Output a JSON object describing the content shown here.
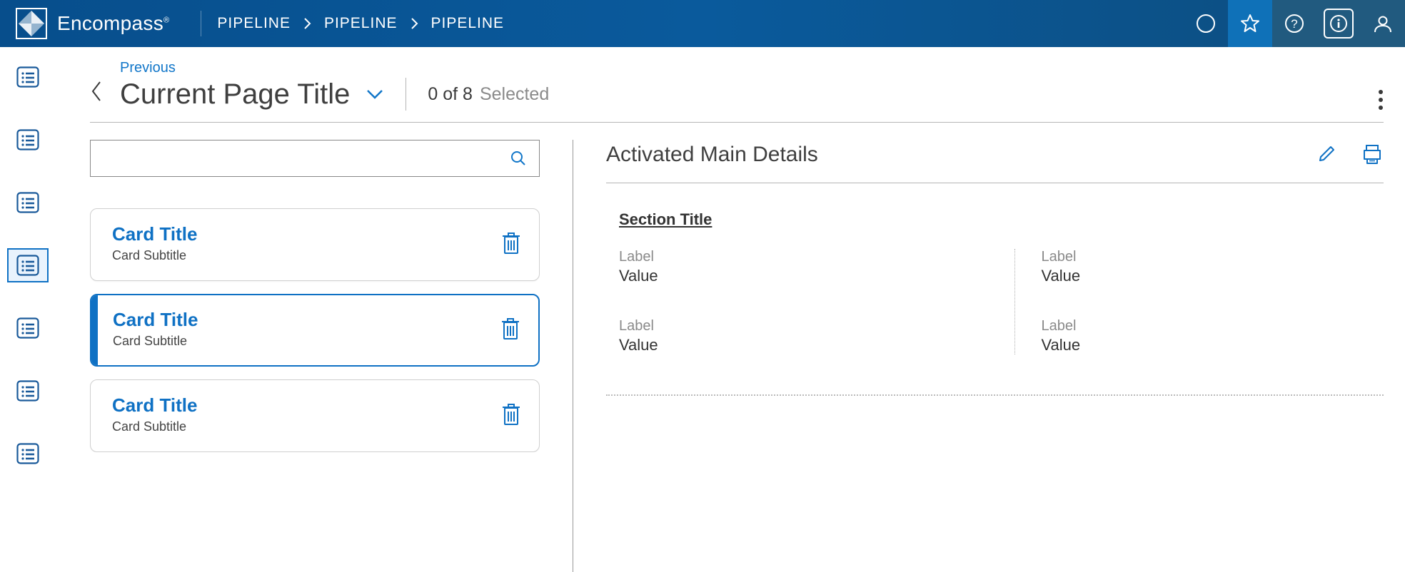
{
  "brand": {
    "name": "Encompass"
  },
  "breadcrumb": [
    "PIPELINE",
    "PIPELINE",
    "PIPELINE"
  ],
  "header": {
    "previous_label": "Previous",
    "page_title": "Current Page Title",
    "selection_count": "0 of 8",
    "selection_label": "Selected"
  },
  "cards": [
    {
      "title": "Card Title",
      "subtitle": "Card Subtitle",
      "selected": false
    },
    {
      "title": "Card Title",
      "subtitle": "Card Subtitle",
      "selected": true
    },
    {
      "title": "Card Title",
      "subtitle": "Card Subtitle",
      "selected": false
    }
  ],
  "details": {
    "title": "Activated Main Details",
    "section_title": "Section Title",
    "fields": [
      {
        "label": "Label",
        "value": "Value"
      },
      {
        "label": "Label",
        "value": "Value"
      },
      {
        "label": "Label",
        "value": "Value"
      },
      {
        "label": "Label",
        "value": "Value"
      }
    ]
  }
}
